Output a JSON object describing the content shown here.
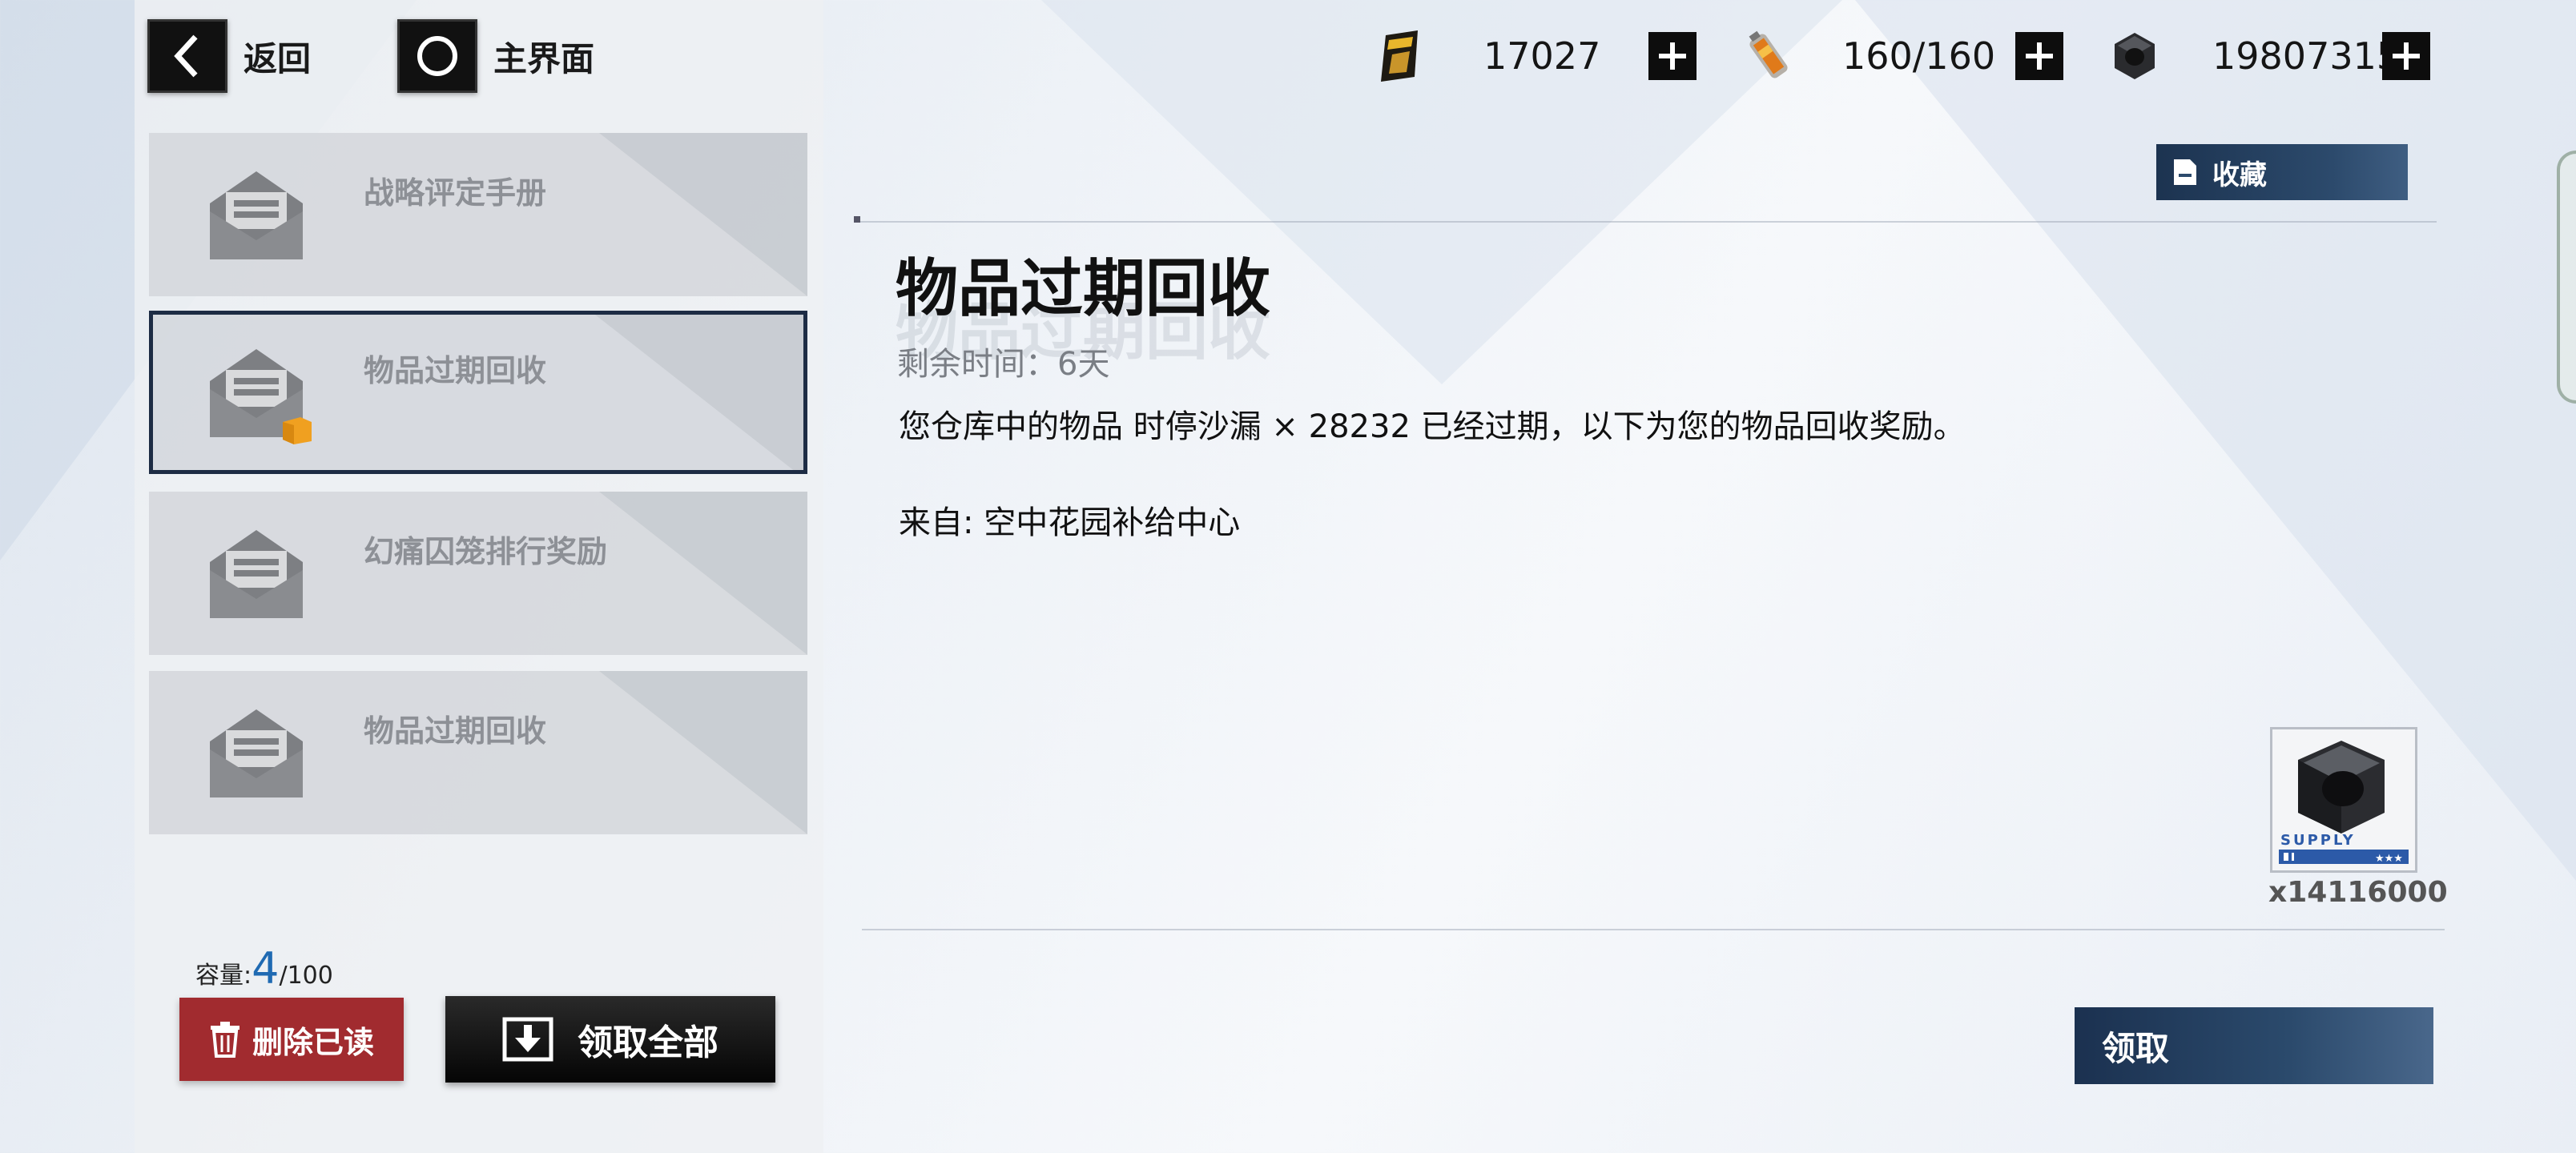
{
  "nav": {
    "back_label": "返回",
    "home_label": "主界面"
  },
  "currencies": [
    {
      "icon": "card-ticket-icon",
      "value": "17027"
    },
    {
      "icon": "battery-energy-icon",
      "value": "160/160"
    },
    {
      "icon": "hex-nut-icon",
      "value": "19807315"
    }
  ],
  "mail_list": [
    {
      "title": "战略评定手册",
      "selected": false,
      "has_attachment": false
    },
    {
      "title": "物品过期回收",
      "selected": true,
      "has_attachment": true
    },
    {
      "title": "幻痛囚笼排行奖励",
      "selected": false,
      "has_attachment": false
    },
    {
      "title": "物品过期回收",
      "selected": false,
      "has_attachment": false
    }
  ],
  "capacity": {
    "label": "容量:",
    "current": "4",
    "max": "/100"
  },
  "actions": {
    "delete_read": "删除已读",
    "claim_all": "领取全部",
    "favorite": "收藏",
    "claim": "领取"
  },
  "mail_detail": {
    "title": "物品过期回收",
    "remaining": "剩余时间：6天",
    "body": "您仓库中的物品 时停沙漏 × 28232 已经过期，以下为您的物品回收奖励。",
    "from": "来自: 空中花园补给中心"
  },
  "reward": {
    "icon": "hex-nut-icon",
    "tag": "SUPPLY",
    "count": "x14116000"
  },
  "colors": {
    "accent_blue": "#1f6ab2",
    "delete_red": "#a12b2f",
    "navy": "#1d2c44"
  }
}
